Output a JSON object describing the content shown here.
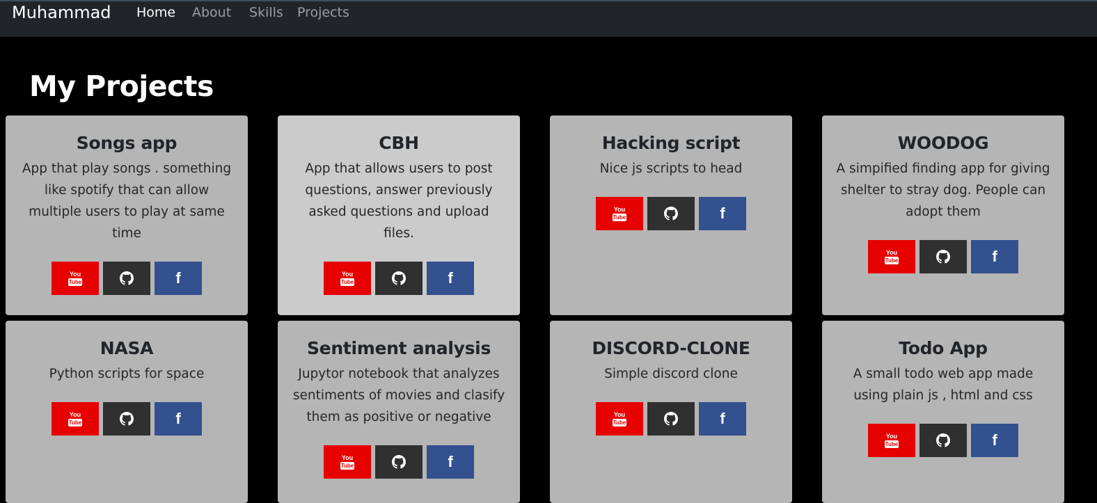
{
  "navbar": {
    "brand": "Muhammad",
    "links": [
      {
        "label": "Home",
        "active": true
      },
      {
        "label": "About",
        "active": false
      },
      {
        "label": "Skills",
        "active": false
      },
      {
        "label": "Projects",
        "active": false
      }
    ]
  },
  "page_title": "My Projects",
  "projects": [
    {
      "title": "Songs app",
      "description": "App that play songs . something like spotify that can allow multiple users to play at same time"
    },
    {
      "title": "CBH",
      "description": "App that allows users to post questions, answer previously asked questions and upload files."
    },
    {
      "title": "Hacking script",
      "description": "Nice js scripts to head"
    },
    {
      "title": "WOODOG",
      "description": "A simpified finding app for giving shelter to stray dog. People can adopt them"
    },
    {
      "title": "NASA",
      "description": "Python scripts for space"
    },
    {
      "title": "Sentiment analysis",
      "description": "Jupytor notebook that analyzes sentiments of movies and clasify them as positive or negative"
    },
    {
      "title": "DISCORD-CLONE",
      "description": "Simple discord clone"
    },
    {
      "title": "Todo App",
      "description": "A small todo web app made using plain js , html and css"
    }
  ],
  "buttons": {
    "youtube_icon": "youtube-icon",
    "github_icon": "github-icon",
    "facebook_icon": "facebook-icon",
    "youtube_you": "You",
    "youtube_tube": "Tube",
    "facebook_glyph": "f"
  },
  "colors": {
    "background": "#000000",
    "navbar": "#212529",
    "card": "#b5b5b5",
    "card_hover": "#cbcbcb",
    "youtube": "#e60000",
    "github": "#303030",
    "facebook": "#33508f"
  }
}
